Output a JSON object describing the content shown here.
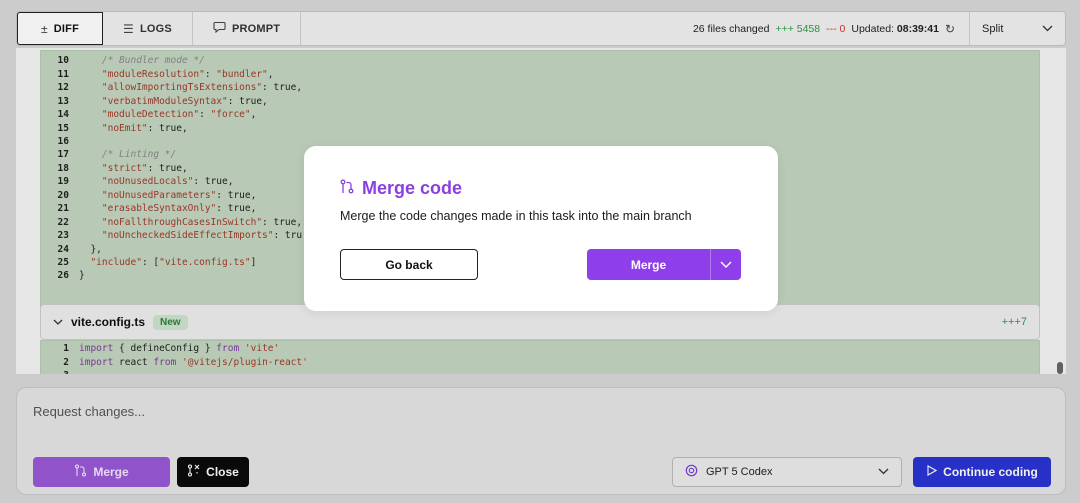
{
  "tabs": [
    {
      "label": "DIFF",
      "icon": "plus-minus-icon",
      "active": true
    },
    {
      "label": "LOGS",
      "icon": "list-icon",
      "active": false
    },
    {
      "label": "PROMPT",
      "icon": "chat-icon",
      "active": false
    }
  ],
  "stats": {
    "files_changed": "26 files changed",
    "additions": "+++ 5458",
    "deletions": "--- 0",
    "updated_label": "Updated:",
    "updated_time": "08:39:41"
  },
  "view_mode": "Split",
  "code_lines": [
    {
      "num": "10",
      "text": "    /* Bundler mode */",
      "kind": "comment"
    },
    {
      "num": "11",
      "text": "    \"moduleResolution\": \"bundler\",",
      "kind": "code"
    },
    {
      "num": "12",
      "text": "    \"allowImportingTsExtensions\": true,",
      "kind": "code"
    },
    {
      "num": "13",
      "text": "    \"verbatimModuleSyntax\": true,",
      "kind": "code"
    },
    {
      "num": "14",
      "text": "    \"moduleDetection\": \"force\",",
      "kind": "code"
    },
    {
      "num": "15",
      "text": "    \"noEmit\": true,",
      "kind": "code"
    },
    {
      "num": "16",
      "text": "",
      "kind": "code"
    },
    {
      "num": "17",
      "text": "    /* Linting */",
      "kind": "comment"
    },
    {
      "num": "18",
      "text": "    \"strict\": true,",
      "kind": "code"
    },
    {
      "num": "19",
      "text": "    \"noUnusedLocals\": true,",
      "kind": "code"
    },
    {
      "num": "20",
      "text": "    \"noUnusedParameters\": true,",
      "kind": "code"
    },
    {
      "num": "21",
      "text": "    \"erasableSyntaxOnly\": true,",
      "kind": "code"
    },
    {
      "num": "22",
      "text": "    \"noFallthroughCasesInSwitch\": true,",
      "kind": "code"
    },
    {
      "num": "23",
      "text": "    \"noUncheckedSideEffectImports\": tru",
      "kind": "code"
    },
    {
      "num": "24",
      "text": "  },",
      "kind": "code"
    },
    {
      "num": "25",
      "text": "  \"include\": [\"vite.config.ts\"]",
      "kind": "code"
    },
    {
      "num": "26",
      "text": "}",
      "kind": "code"
    }
  ],
  "file2": {
    "name": "vite.config.ts",
    "badge": "New",
    "additions": "+++7",
    "lines": [
      {
        "num": "1",
        "text": "import { defineConfig } from 'vite'"
      },
      {
        "num": "2",
        "text": "import react from '@vitejs/plugin-react'"
      },
      {
        "num": "3",
        "text": ""
      }
    ]
  },
  "composer": {
    "placeholder": "Request changes...",
    "merge_label": "Merge",
    "close_label": "Close",
    "model": "GPT 5 Codex",
    "continue_label": "Continue coding"
  },
  "modal": {
    "title": "Merge code",
    "description": "Merge the code changes made in this task into the main branch",
    "go_back_label": "Go back",
    "merge_label": "Merge"
  },
  "colors": {
    "accent_purple": "#8f3fe9",
    "continue_blue": "#2b35d4",
    "add_green": "#2e9b46",
    "del_red": "#d23a2a",
    "code_bg": "#c4d7c1"
  }
}
